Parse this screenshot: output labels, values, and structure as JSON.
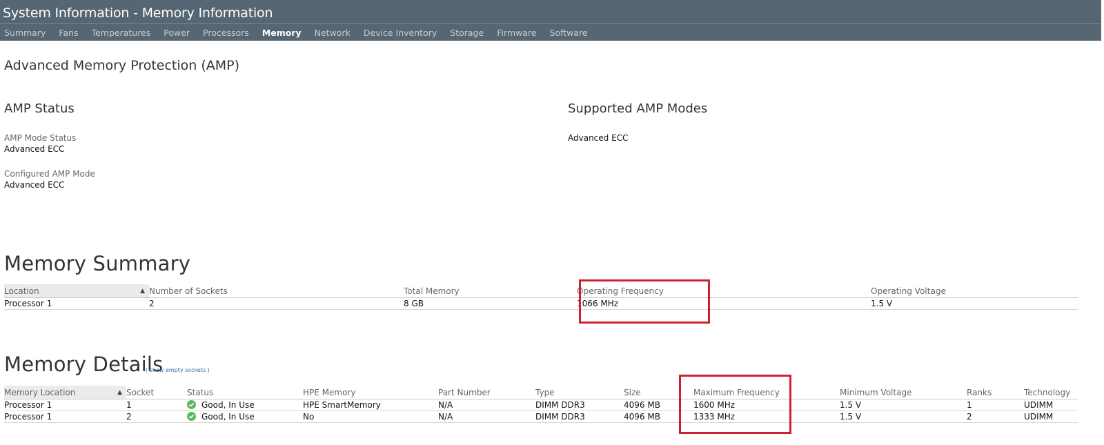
{
  "header": {
    "title": "System Information - Memory Information",
    "tabs": [
      {
        "label": "Summary",
        "active": false
      },
      {
        "label": "Fans",
        "active": false
      },
      {
        "label": "Temperatures",
        "active": false
      },
      {
        "label": "Power",
        "active": false
      },
      {
        "label": "Processors",
        "active": false
      },
      {
        "label": "Memory",
        "active": true
      },
      {
        "label": "Network",
        "active": false
      },
      {
        "label": "Device Inventory",
        "active": false
      },
      {
        "label": "Storage",
        "active": false
      },
      {
        "label": "Firmware",
        "active": false
      },
      {
        "label": "Software",
        "active": false
      }
    ]
  },
  "amp": {
    "title": "Advanced Memory Protection (AMP)",
    "status_title": "AMP Status",
    "mode_status_label": "AMP Mode Status",
    "mode_status_value": "Advanced ECC",
    "configured_label": "Configured AMP Mode",
    "configured_value": "Advanced ECC",
    "supported_title": "Supported AMP Modes",
    "supported_value": "Advanced ECC"
  },
  "summary": {
    "title": "Memory Summary",
    "columns": [
      "Location",
      "Number of Sockets",
      "Total Memory",
      "Operating Frequency",
      "Operating Voltage"
    ],
    "rows": [
      [
        "Processor 1",
        "2",
        "8 GB",
        "1066 MHz",
        "1.5 V"
      ]
    ]
  },
  "details": {
    "title": "Memory Details",
    "show_empty_link": "( show empty sockets )",
    "columns": [
      "Memory Location",
      "Socket",
      "Status",
      "HPE Memory",
      "Part Number",
      "Type",
      "Size",
      "Maximum Frequency",
      "Minimum Voltage",
      "Ranks",
      "Technology"
    ],
    "rows": [
      [
        "Processor 1",
        "1",
        "Good, In Use",
        "HPE SmartMemory",
        "N/A",
        "DIMM DDR3",
        "4096 MB",
        "1600 MHz",
        "1.5 V",
        "1",
        "UDIMM"
      ],
      [
        "Processor 1",
        "2",
        "Good, In Use",
        "No",
        "N/A",
        "DIMM DDR3",
        "4096 MB",
        "1333 MHz",
        "1.5 V",
        "2",
        "UDIMM"
      ]
    ]
  },
  "colors": {
    "header_bg": "#566672",
    "highlight": "#d0202e",
    "status_ok": "#5cb85c"
  },
  "icons": {
    "sort": "sort-asc-icon",
    "status": "check-circle-icon"
  }
}
